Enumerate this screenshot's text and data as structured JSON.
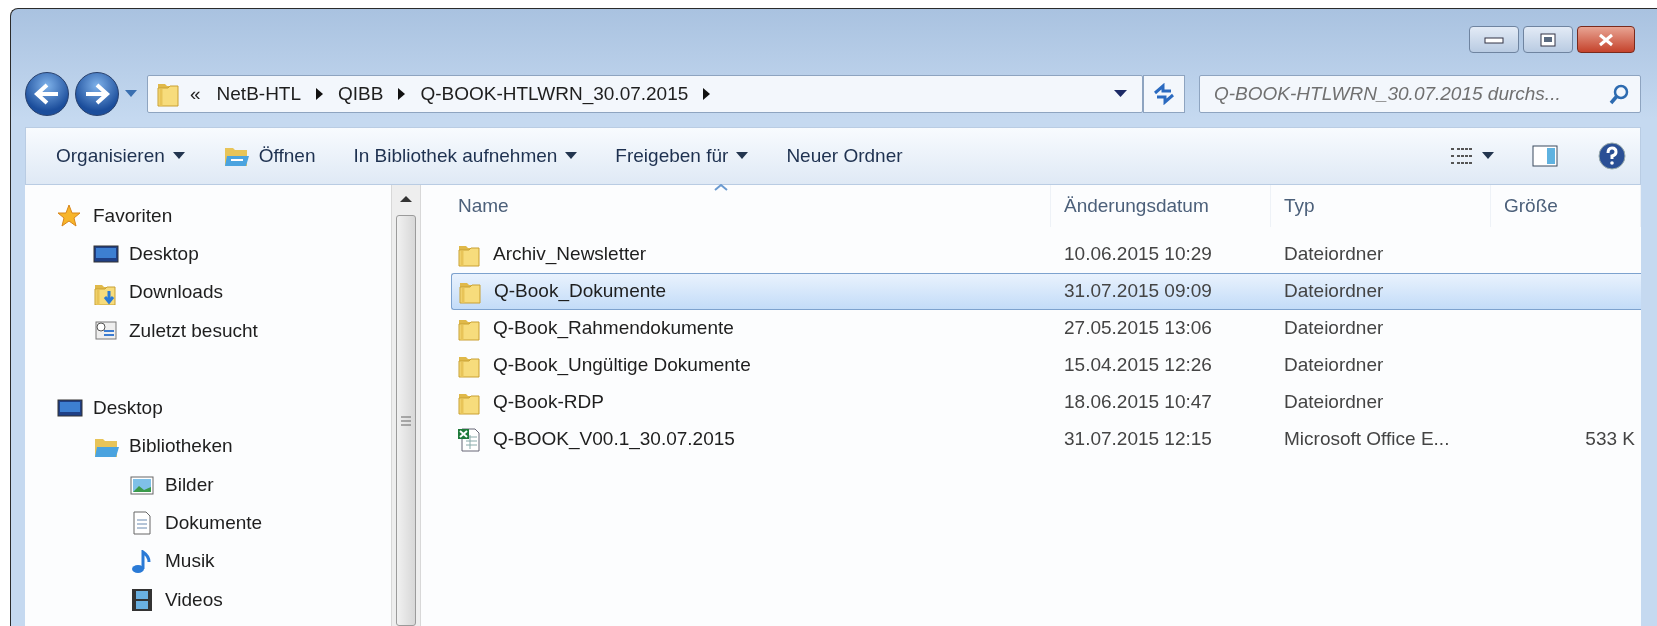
{
  "address_bar": {
    "overflow_mark": "«",
    "path": [
      "NetB-HTL",
      "QIBB",
      "Q-BOOK-HTLWRN_30.07.2015"
    ]
  },
  "search": {
    "placeholder": "Q-BOOK-HTLWRN_30.07.2015 durchs..."
  },
  "toolbar": [
    {
      "label": "Organisieren",
      "kind": "menu"
    },
    {
      "label": "Öffnen",
      "kind": "icon"
    },
    {
      "label": "In Bibliothek aufnehmen",
      "kind": "menu"
    },
    {
      "label": "Freigeben für",
      "kind": "menu"
    },
    {
      "label": "Neuer Ordner",
      "kind": "plain"
    }
  ],
  "navigation": [
    {
      "label": "Favoriten",
      "kind": "favorites",
      "children": [
        {
          "label": "Desktop",
          "kind": "desktop"
        },
        {
          "label": "Downloads",
          "kind": "downloads"
        },
        {
          "label": "Zuletzt besucht",
          "kind": "recent"
        }
      ]
    },
    {
      "label": "Desktop",
      "kind": "desktop",
      "children": [
        {
          "label": "Bibliotheken",
          "kind": "libraries",
          "children": [
            {
              "label": "Bilder",
              "kind": "pictures"
            },
            {
              "label": "Dokumente",
              "kind": "documents"
            },
            {
              "label": "Musik",
              "kind": "music"
            },
            {
              "label": "Videos",
              "kind": "videos"
            }
          ]
        }
      ]
    }
  ],
  "file_list": {
    "columns": [
      {
        "label": "Name",
        "sorted": true
      },
      {
        "label": "Änderungsdatum",
        "sorted": false
      },
      {
        "label": "Typ",
        "sorted": false
      },
      {
        "label": "Größe",
        "sorted": false
      }
    ],
    "rows": [
      {
        "name": "Archiv_Newsletter",
        "kind": "folder",
        "modified": "10.06.2015 10:29",
        "type": "Dateiordner",
        "selected": false
      },
      {
        "name": "Q-Book_Dokumente",
        "kind": "folder",
        "modified": "31.07.2015 09:09",
        "type": "Dateiordner",
        "selected": true
      },
      {
        "name": "Q-Book_Rahmendokumente",
        "kind": "folder",
        "modified": "27.05.2015 13:06",
        "type": "Dateiordner",
        "selected": false
      },
      {
        "name": "Q-Book_Ungültige Dokumente",
        "kind": "folder",
        "modified": "15.04.2015 12:26",
        "type": "Dateiordner",
        "selected": false
      },
      {
        "name": "Q-Book-RDP",
        "kind": "folder",
        "modified": "18.06.2015 10:47",
        "type": "Dateiordner",
        "selected": false
      },
      {
        "name": "Q-BOOK_V00.1_30.07.2015",
        "kind": "spreadsheet",
        "modified": "31.07.2015 12:15",
        "type": "Microsoft Office E...",
        "size": "533 K",
        "selected": false
      }
    ]
  }
}
